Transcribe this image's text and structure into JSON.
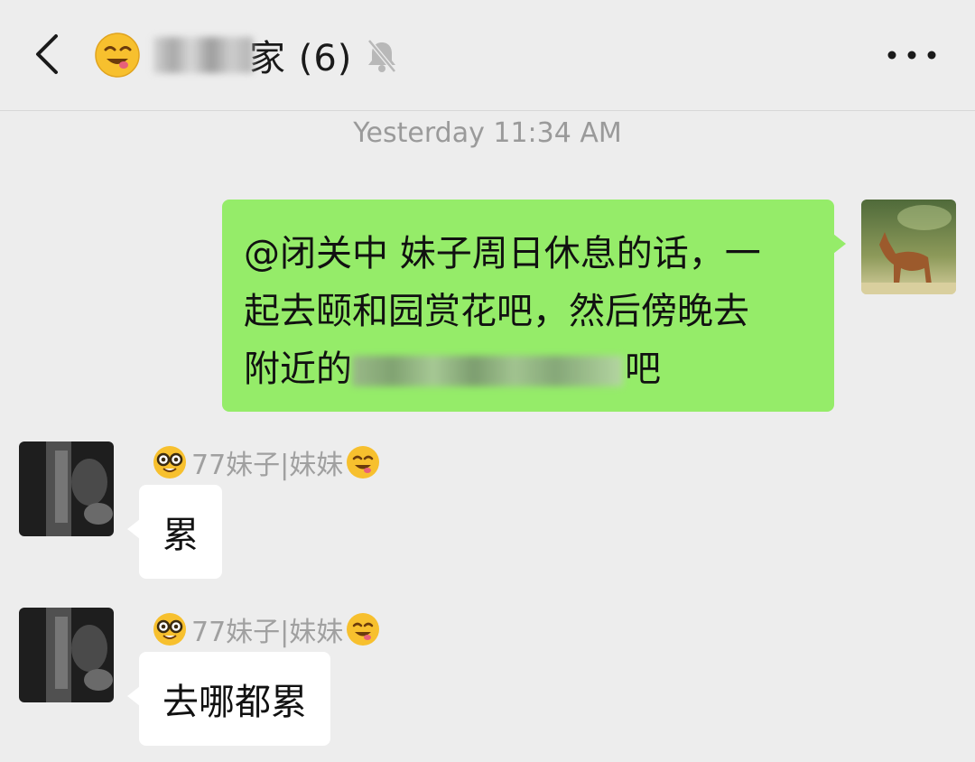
{
  "header": {
    "title": "家 (6)",
    "back_icon": "chevron-left-icon",
    "mute_icon": "bell-muted-icon",
    "more_icon": "more-dots-icon"
  },
  "timestamp": "Yesterday 11:34 AM",
  "outgoing": {
    "line1": "@闭关中 妹子周日休息的话，一",
    "line2": "起去颐和园赏花吧，然后傍晚去",
    "line3_before": "附近的",
    "line3_after": "吧",
    "bubble_color": "#95ec69"
  },
  "messages": [
    {
      "sender": "77妹子|妹妹",
      "text": "累"
    },
    {
      "sender": "77妹子|妹妹",
      "text": "去哪都累"
    }
  ]
}
